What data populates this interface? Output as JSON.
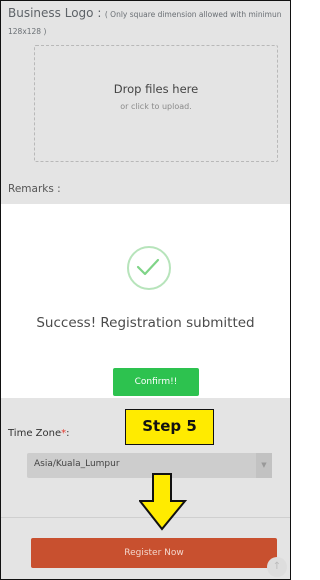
{
  "form": {
    "logo_label": "Business Logo :",
    "logo_note": "( Only square dimension allowed with minimun 128x128 )",
    "dropzone_title": "Drop files here",
    "dropzone_subtitle": "or click to upload.",
    "remarks_label": "Remarks :",
    "timezone_label": "Time Zone",
    "timezone_required": "*",
    "timezone_suffix": ":",
    "timezone_value": "Asia/Kuala_Lumpur",
    "register_label": "Register Now"
  },
  "modal": {
    "success_text": "Success! Registration submitted",
    "confirm_label": "Confirm!!"
  },
  "annotation": {
    "step_label": "Step 5",
    "highlight_color": "#ffeb00"
  },
  "icons": {
    "success": "check-icon",
    "dropdown": "chevron-down-icon",
    "scroll_top": "arrow-up-icon",
    "pointer": "down-arrow-icon"
  },
  "colors": {
    "confirm_button": "#2dc24f",
    "register_button": "#c8502f",
    "check": "#7fd487"
  }
}
